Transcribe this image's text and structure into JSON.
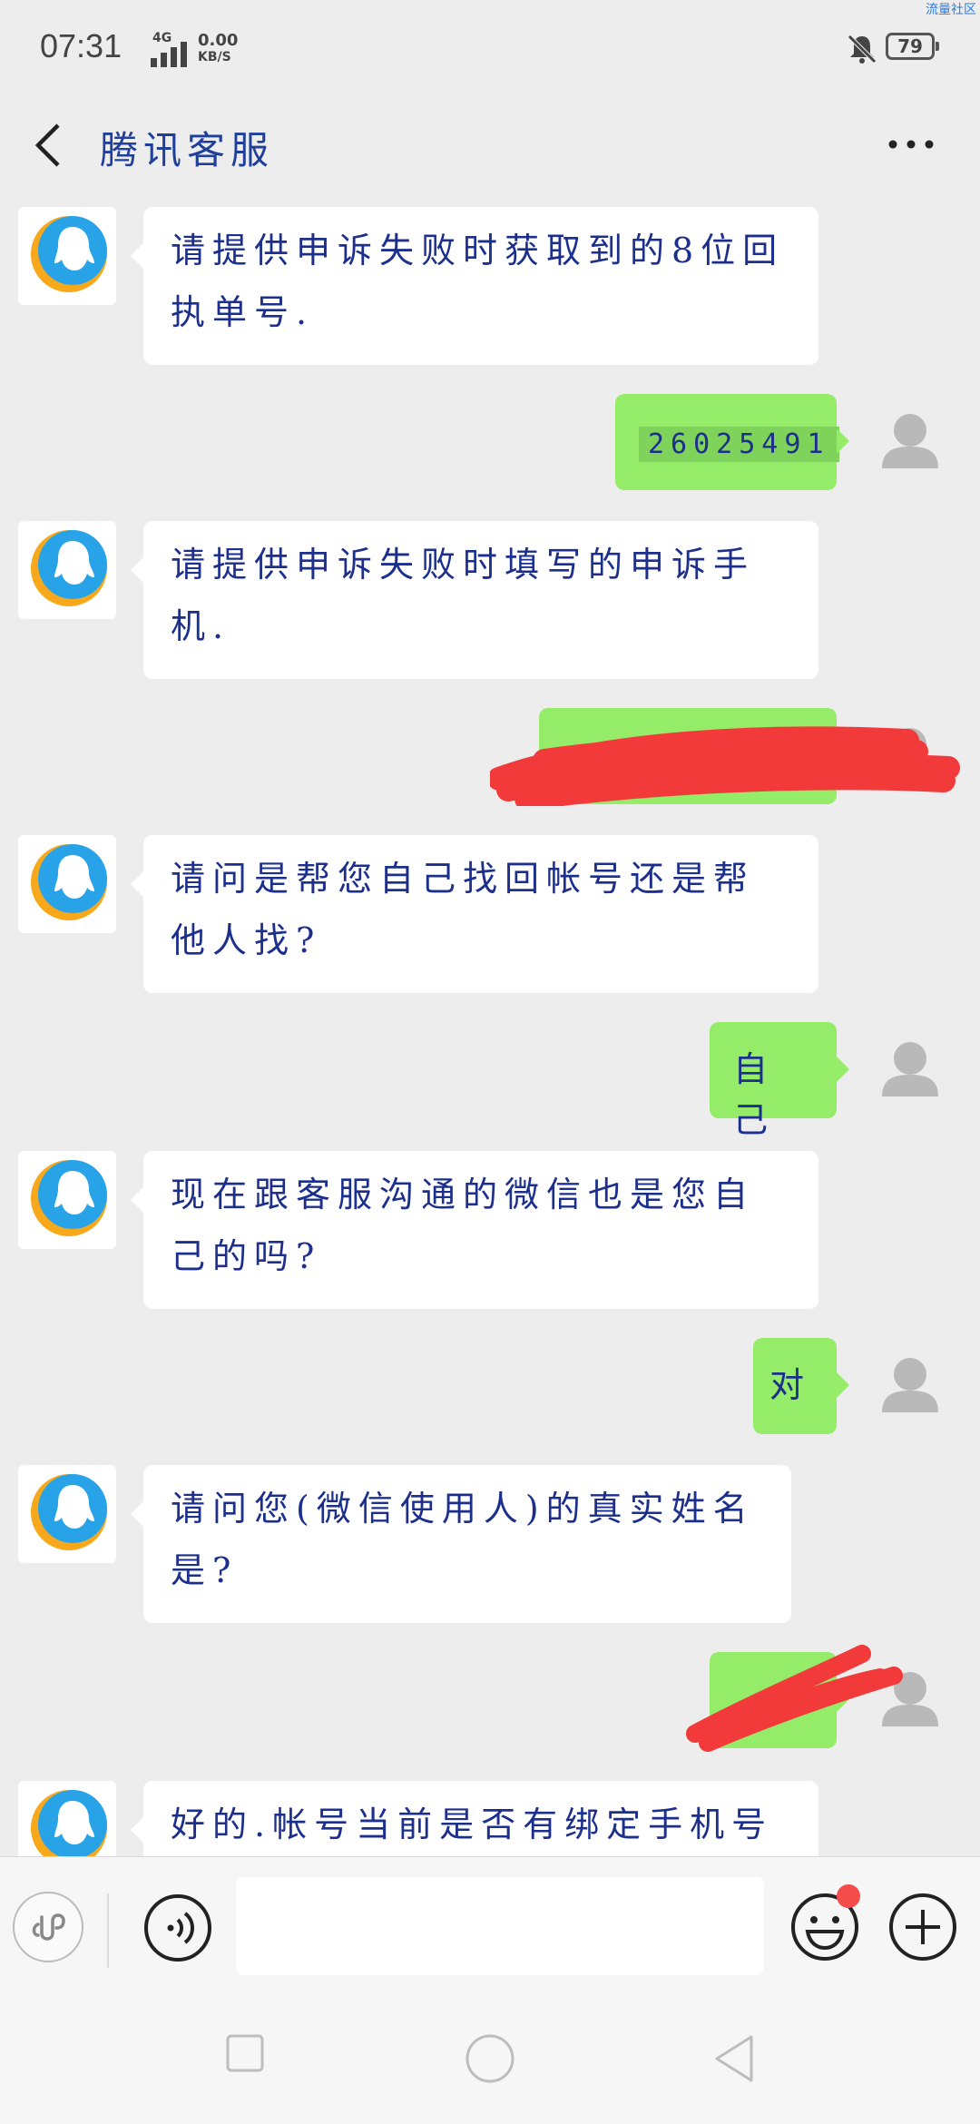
{
  "status_bar": {
    "time": "07:31",
    "network": "4G",
    "speed_value": "0.00",
    "speed_unit": "KB/S",
    "battery": "79",
    "watermark": "流量社区",
    "icons": [
      "signal-icon",
      "mute-bell-icon",
      "battery-icon"
    ]
  },
  "header": {
    "title": "腾讯客服",
    "back_icon": "chevron-left-icon",
    "more_icon": "more-dots-icon"
  },
  "messages": [
    {
      "from": "service",
      "lines": [
        "请提供申诉失败时获取到的8位回",
        "执单号."
      ]
    },
    {
      "from": "user",
      "text": "26025491"
    },
    {
      "from": "service",
      "lines": [
        "请提供申诉失败时填写的申诉手",
        "机."
      ]
    },
    {
      "from": "user",
      "text": "",
      "redacted": true
    },
    {
      "from": "service",
      "lines": [
        "请问是帮您自己找回帐号还是帮",
        "他人找?"
      ]
    },
    {
      "from": "user",
      "text": "自己"
    },
    {
      "from": "service",
      "lines": [
        "现在跟客服沟通的微信也是您自",
        "己的吗?"
      ]
    },
    {
      "from": "user",
      "text": "对"
    },
    {
      "from": "service",
      "lines": [
        "请问您(微信使用人)的真实姓名",
        "是?"
      ]
    },
    {
      "from": "user",
      "text": "",
      "redacted": true
    },
    {
      "from": "service",
      "lines": [
        "好的.帐号当前是否有绑定手机号"
      ]
    }
  ],
  "input_bar": {
    "placeholder": "",
    "icons": [
      "mini-program-icon",
      "voice-icon",
      "emoji-icon",
      "plus-icon"
    ]
  },
  "nav_bar": {
    "icons": [
      "recent-apps-icon",
      "home-icon",
      "back-triangle-icon"
    ]
  },
  "colors": {
    "background": "#ededed",
    "bubble_out": "#95ec69",
    "bubble_in": "#ffffff",
    "text": "#1c2f8c",
    "redaction": "#f23a3a"
  }
}
